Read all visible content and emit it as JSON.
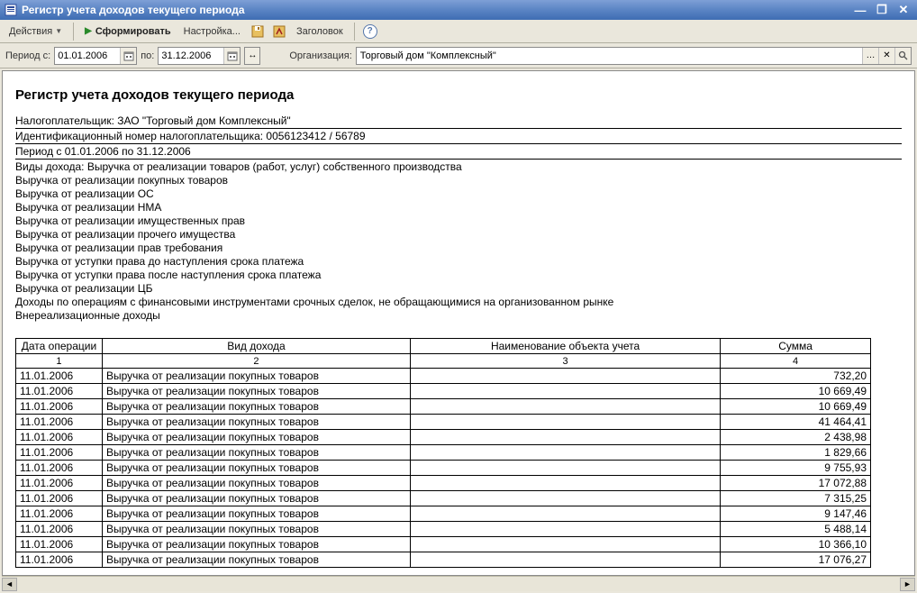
{
  "window": {
    "title": "Регистр учета доходов текущего периода"
  },
  "toolbar": {
    "actions_label": "Действия",
    "generate_label": "Сформировать",
    "settings_label": "Настройка...",
    "header_label": "Заголовок"
  },
  "filter": {
    "period_from_label": "Период с:",
    "period_from": "01.01.2006",
    "period_to_label": "по:",
    "period_to": "31.12.2006",
    "org_label": "Организация:",
    "org_value": "Торговый дом \"Комплексный\""
  },
  "report": {
    "title": "Регистр учета доходов текущего периода",
    "taxpayer_line": "Налогоплательщик: ЗАО \"Торговый дом Комплексный\"",
    "inn_line": "Идентификационный номер налогоплательщика: 0056123412 / 56789",
    "period_line": "Период с 01.01.2006 по 31.12.2006",
    "income_types_label": "Виды дохода: Выручка от реализации товаров (работ, услуг) собственного производства",
    "income_types": [
      "Выручка от реализации покупных товаров",
      "Выручка от реализации ОС",
      "Выручка от реализации НМА",
      "Выручка от реализации имущественных прав",
      "Выручка от реализации прочего имущества",
      "Выручка от реализации прав требования",
      "Выручка от уступки права до наступления срока платежа",
      "Выручка от уступки права после наступления срока платежа",
      "Выручка от реализации ЦБ",
      "Доходы по операциям с финансовыми инструментами срочных сделок, не обращающимися на организованном рынке",
      "Внереализационные доходы"
    ],
    "columns": {
      "date": "Дата операции",
      "type": "Вид дохода",
      "object": "Наименование объекта учета",
      "sum": "Сумма",
      "n1": "1",
      "n2": "2",
      "n3": "3",
      "n4": "4"
    },
    "rows": [
      {
        "date": "11.01.2006",
        "type": "Выручка от реализации покупных товаров",
        "object": "",
        "sum": "732,20"
      },
      {
        "date": "11.01.2006",
        "type": "Выручка от реализации покупных товаров",
        "object": "",
        "sum": "10 669,49"
      },
      {
        "date": "11.01.2006",
        "type": "Выручка от реализации покупных товаров",
        "object": "",
        "sum": "10 669,49"
      },
      {
        "date": "11.01.2006",
        "type": "Выручка от реализации покупных товаров",
        "object": "",
        "sum": "41 464,41"
      },
      {
        "date": "11.01.2006",
        "type": "Выручка от реализации покупных товаров",
        "object": "",
        "sum": "2 438,98"
      },
      {
        "date": "11.01.2006",
        "type": "Выручка от реализации покупных товаров",
        "object": "",
        "sum": "1 829,66"
      },
      {
        "date": "11.01.2006",
        "type": "Выручка от реализации покупных товаров",
        "object": "",
        "sum": "9 755,93"
      },
      {
        "date": "11.01.2006",
        "type": "Выручка от реализации покупных товаров",
        "object": "",
        "sum": "17 072,88"
      },
      {
        "date": "11.01.2006",
        "type": "Выручка от реализации покупных товаров",
        "object": "",
        "sum": "7 315,25"
      },
      {
        "date": "11.01.2006",
        "type": "Выручка от реализации покупных товаров",
        "object": "",
        "sum": "9 147,46"
      },
      {
        "date": "11.01.2006",
        "type": "Выручка от реализации покупных товаров",
        "object": "",
        "sum": "5 488,14"
      },
      {
        "date": "11.01.2006",
        "type": "Выручка от реализации покупных товаров",
        "object": "",
        "sum": "10 366,10"
      },
      {
        "date": "11.01.2006",
        "type": "Выручка от реализации покупных товаров",
        "object": "",
        "sum": "17 076,27"
      }
    ]
  }
}
